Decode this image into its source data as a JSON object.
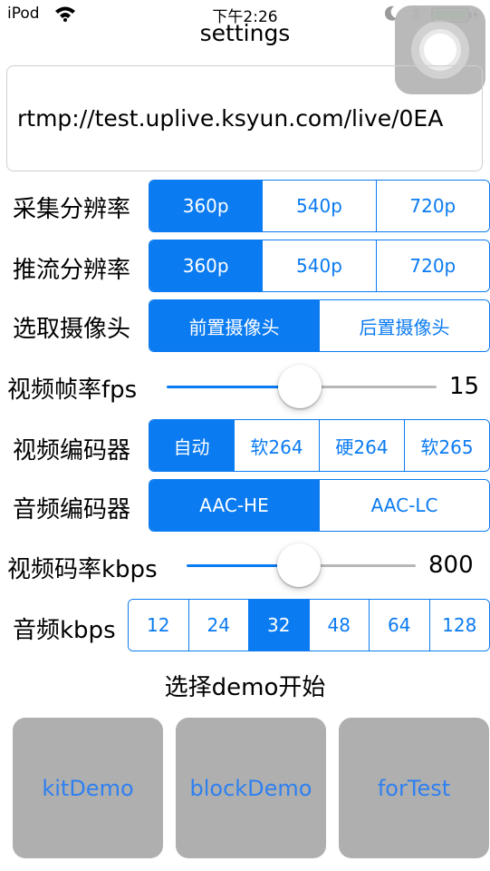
{
  "status_bar": {
    "carrier": "iPod",
    "time": "下午2:26",
    "icons": [
      "wifi-icon",
      "moon-icon",
      "bluetooth-icon",
      "battery-charging-icon"
    ]
  },
  "title": "settings",
  "url": "rtmp://test.uplive.ksyun.com/live/0EA",
  "capture_resolution": {
    "label": "采集分辨率",
    "options": [
      "360p",
      "540p",
      "720p"
    ],
    "selected": "360p"
  },
  "stream_resolution": {
    "label": "推流分辨率",
    "options": [
      "360p",
      "540p",
      "720p"
    ],
    "selected": "360p"
  },
  "camera": {
    "label": "选取摄像头",
    "options": [
      "前置摄像头",
      "后置摄像头"
    ],
    "selected": "前置摄像头"
  },
  "fps": {
    "label": "视频帧率fps",
    "value": "15",
    "fraction": 0.49
  },
  "video_encoder": {
    "label": "视频编码器",
    "options": [
      "自动",
      "软264",
      "硬264",
      "软265"
    ],
    "selected": "自动"
  },
  "audio_encoder": {
    "label": "音频编码器",
    "options": [
      "AAC-HE",
      "AAC-LC"
    ],
    "selected": "AAC-HE"
  },
  "video_bitrate": {
    "label": "视频码率kbps",
    "value": "800",
    "fraction": 0.49
  },
  "audio_bitrate": {
    "label": "音频kbps",
    "options": [
      "12",
      "24",
      "32",
      "48",
      "64",
      "128"
    ],
    "selected": "32"
  },
  "demo_heading": "选择demo开始",
  "demo_buttons": [
    "kitDemo",
    "blockDemo",
    "forTest"
  ],
  "colors": {
    "accent": "#0b7bf1",
    "demo_button_bg": "#afafaf",
    "demo_button_text": "#2f80f0",
    "track_inactive": "#b7b7b7"
  }
}
